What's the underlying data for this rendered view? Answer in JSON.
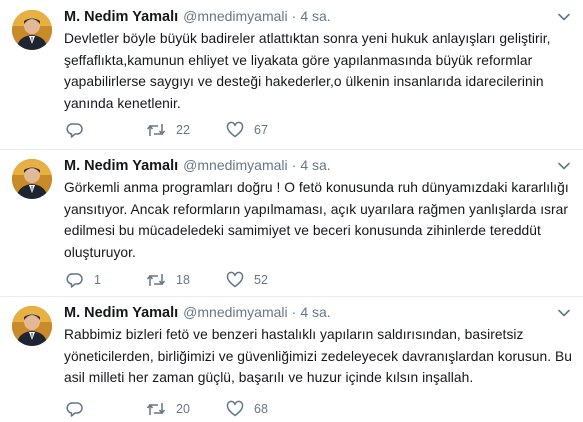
{
  "tweets": [
    {
      "author": {
        "name": "M. Nedim Yamalı",
        "handle": "@mnedimyamali"
      },
      "separator": "·",
      "time": "4 sa.",
      "text_lines": [
        "Devletler böyle büyük badireler atlattıktan sonra yeni hukuk anlayışları geliştirir,",
        "şeffaflıkta,kamunun ehliyet ve liyakata göre yapılanmasında büyük reformlar",
        "yapabilirlerse saygıyı ve desteği hakederler,o ülkenin insanlarıda idarecilerinin",
        "yanında kenetlenir."
      ],
      "counts": {
        "reply": "",
        "retweet": "22",
        "like": "67"
      }
    },
    {
      "author": {
        "name": "M. Nedim Yamalı",
        "handle": "@mnedimyamali"
      },
      "separator": "·",
      "time": "4 sa.",
      "text_lines": [
        "Görkemli anma programları doğru ! O fetö konusunda ruh dünyamızdaki kararlılığı",
        "yansıtıyor. Ancak reformların yapılmaması, açık uyarılara rağmen yanlışlarda ısrar",
        "edilmesi bu mücadeledeki samimiyet ve beceri konusunda zihinlerde tereddüt",
        "oluşturuyor."
      ],
      "counts": {
        "reply": "1",
        "retweet": "18",
        "like": "52"
      }
    },
    {
      "author": {
        "name": "M. Nedim Yamalı",
        "handle": "@mnedimyamali"
      },
      "separator": "·",
      "time": "4 sa.",
      "text_lines": [
        "Rabbimiz bizleri fetö ve benzeri hastalıklı yapıların saldırısından, basiretsiz",
        "yöneticilerden, birliğimizi ve güvenliğimizi zedeleyecek davranışlardan korusun. Bu",
        "asil milleti her zaman güçlü, başarılı  ve huzur içinde kılsın inşallah."
      ],
      "counts": {
        "reply": "",
        "retweet": "20",
        "like": "68"
      }
    }
  ],
  "icons": {
    "reply": "reply-icon",
    "retweet": "retweet-icon",
    "like": "heart-icon",
    "caret": "chevron-down-icon"
  },
  "colors": {
    "text": "#14171a",
    "secondary": "#657786",
    "divider": "#e6ecf0"
  }
}
